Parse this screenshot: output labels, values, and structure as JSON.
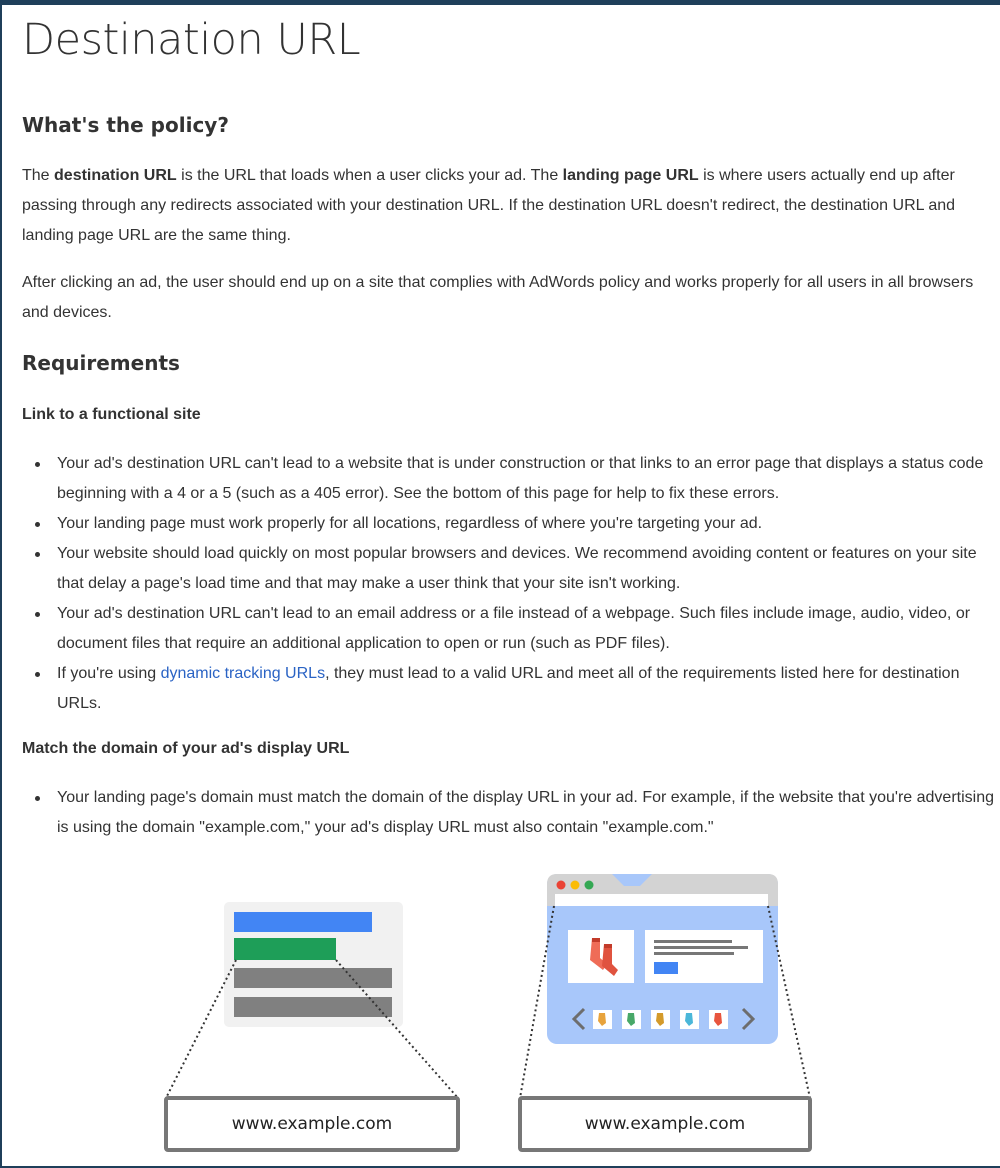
{
  "page_title": "Destination URL",
  "policy": {
    "heading": "What's the policy?",
    "p1": {
      "t1": "The ",
      "b1": "destination URL",
      "t2": " is the URL that loads when a user clicks your ad. The ",
      "b2": "landing page URL",
      "t3": " is where users actually end up after passing through any redirects associated with your destination URL. If the destination URL doesn't redirect, the destination URL and landing page URL are the same thing."
    },
    "p2": "After clicking an ad, the user should end up on a site that complies with AdWords policy and works properly for all users in all browsers and devices."
  },
  "requirements": {
    "heading": "Requirements",
    "functional": {
      "heading": "Link to a functional site",
      "items": [
        "Your ad's destination URL can't lead to a website that is under construction or that links to an error page that displays a status code beginning with a 4 or a 5 (such as a 405 error). See the bottom of this page for help to fix these errors.",
        "Your landing page must work properly for all locations, regardless of where you're targeting your ad.",
        "Your website should load quickly on most popular browsers and devices. We recommend avoiding content or features on your site that delay a page's load time and that may make a user think that your site isn't working.",
        "Your ad's destination URL can't lead to an email address or a file instead of a webpage. Such files include image, audio, video, or document files that require an additional application to open or run (such as PDF files)."
      ],
      "last_item": {
        "before": "If you're using ",
        "link": "dynamic tracking URLs",
        "after": ", they must lead to a valid URL and meet all of the requirements listed here for destination URLs."
      }
    },
    "domain": {
      "heading": "Match the domain of your ad's display URL",
      "items": [
        "Your landing page's domain must match the domain of the display URL in your ad. For example, if the website that you're advertising is using the domain \"example.com,\" your ad's display URL must also contain \"example.com.\""
      ]
    }
  },
  "illustration": {
    "left_url": "www.example.com",
    "right_url": "www.example.com",
    "colors": {
      "blue": "#4285f4",
      "green": "#1e9e58",
      "gray_bar": "#808080",
      "panel_bg": "#f1f1f1",
      "browser_body": "#a8c7fa",
      "browser_chrome": "#d3d3d3",
      "red_dot": "#ea4335",
      "yellow_dot": "#fbbc04",
      "green_dot": "#34a853"
    }
  }
}
